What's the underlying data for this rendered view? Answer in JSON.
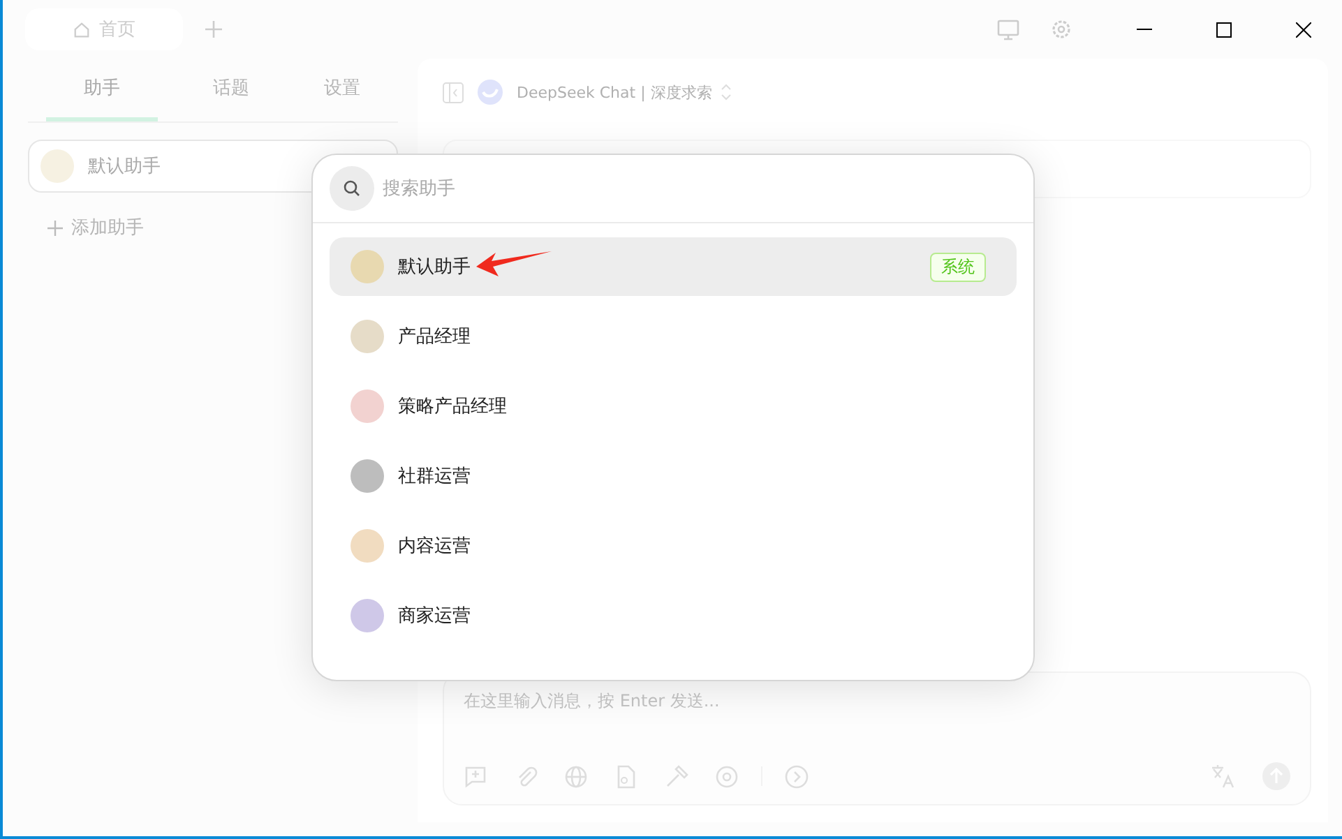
{
  "top_tab": {
    "label": "首页"
  },
  "sidebar": {
    "tabs": [
      {
        "label": "助手",
        "selected": true
      },
      {
        "label": "话题",
        "selected": false
      },
      {
        "label": "设置",
        "selected": false
      }
    ],
    "assistants": [
      {
        "name": "默认助手",
        "selected": true
      }
    ],
    "add_label": "添加助手"
  },
  "chat": {
    "model": "DeepSeek Chat | 深度求索",
    "input_placeholder": "在这里输入消息，按 Enter 发送..."
  },
  "picker": {
    "search_placeholder": "搜索助手",
    "items": [
      {
        "name": "默认助手",
        "selected": true,
        "badge": "系统",
        "color": "#e8d9b0"
      },
      {
        "name": "产品经理",
        "selected": false,
        "color": "#e6dcc8"
      },
      {
        "name": "策略产品经理",
        "selected": false,
        "color": "#f2d2d0"
      },
      {
        "name": "社群运营",
        "selected": false,
        "color": "#bdbdbd"
      },
      {
        "name": "内容运营",
        "selected": false,
        "color": "#f1dcc0"
      },
      {
        "name": "商家运营",
        "selected": false,
        "color": "#cfc8e8"
      }
    ]
  }
}
